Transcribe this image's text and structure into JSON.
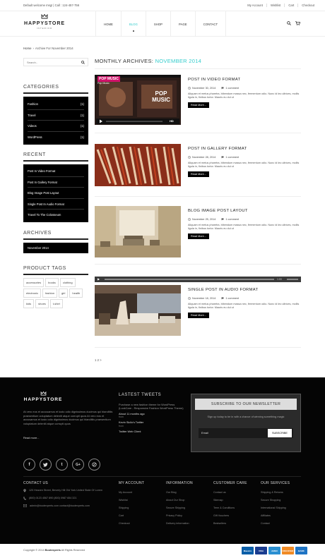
{
  "topbar": {
    "welcome": "Default welcome msg! | Call : 124-457-756",
    "links": [
      "My Account",
      "Wishlist",
      "Cart",
      "Checkout"
    ]
  },
  "header": {
    "logo_name": "HAPPYSTORE",
    "logo_sub": "INTERIOR",
    "nav": [
      "HOME",
      "BLOG",
      "SHOP",
      "PAGE",
      "CONTACT"
    ],
    "active_nav": "BLOG",
    "icons": [
      "search-icon",
      "cart-icon"
    ]
  },
  "breadcrumb": {
    "home": "Home",
    "current": "Archive For November 2014"
  },
  "sidebar": {
    "search_placeholder": "Search..",
    "categories_title": "CATEGORIES",
    "categories": [
      {
        "name": "Fashion",
        "count": "(1)"
      },
      {
        "name": "Travel",
        "count": "(1)"
      },
      {
        "name": "Videos",
        "count": "(1)"
      },
      {
        "name": "WordPress",
        "count": "(1)"
      }
    ],
    "recent_title": "RECENT",
    "recent": [
      "Post In Video Format",
      "Post In Gallery Format",
      "Blog Image Post Layout",
      "Single Post In Audio Format",
      "Travel To The Colosseum"
    ],
    "archives_title": "ARCHIVES",
    "archives": [
      "November 2014"
    ],
    "tags_title": "PRODUCT TAGS",
    "tags": [
      "accessories",
      "books",
      "clothing",
      "electronic",
      "fashion",
      "girl",
      "health",
      "kids",
      "shoes",
      "t-shirt"
    ]
  },
  "main": {
    "archive_label": "MONTHLY ARCHIVES: ",
    "archive_month": "NOVEMBER 2014",
    "posts": [
      {
        "title": "POST IN VIDEO FORMAT",
        "date": "November 30, 2014",
        "comments": "1 comment",
        "excerpt": "Aliquam et metus pharetra, bibendum massa nec, fermentum odio. Nunc id leo ultrices, mollis ligula in, finibus tortor. Mauris eu dui ut",
        "more": "Read More..."
      },
      {
        "title": "POST IN GALLERY FORMAT",
        "date": "November 28, 2014",
        "comments": "1 comment",
        "excerpt": "Aliquam et metus pharetra, bibendum massa nec, fermentum odio. Nunc id leo ultrices, mollis ligula in, finibus tortor. Mauris eu dui ut",
        "more": "Read More..."
      },
      {
        "title": "BLOG IMAGE POST LAYOUT",
        "date": "November 25, 2014",
        "comments": "1 comment",
        "excerpt": "Aliquam et metus pharetra, bibendum massa nec, fermentum odio. Nunc id leo ultrices, mollis ligula in, finibus tortor. Mauris eu dui ut",
        "more": "Read More..."
      },
      {
        "title": "SINGLE POST IN AUDIO FORMAT",
        "date": "November 18, 2014",
        "comments": "1 comment",
        "excerpt": "Aliquam et metus pharetra, bibendum massa nec, fermentum odio. Nunc id leo ultrices, mollis ligula in, finibus tortor. Mauris eu dui ut",
        "more": "Read More..."
      }
    ],
    "video_thumb": {
      "badge": "POP MUSIC",
      "caption": "Pop Music",
      "hd": "HD"
    },
    "audio_time": "1:00",
    "pagination": "1  2  >"
  },
  "footer": {
    "logo_name": "HAPPYSTORE",
    "about": "At vero eos et accusamus et iusto odio dignissimos ducimus qui blanditiis praesentium voluptatum deleniti atque corrupti quos At vero eos et accusamus et iusto odio dignissimos ducimus qui blanditiis praesentium voluptatum deleniti atque corrupti quos",
    "read_more": "Read more...",
    "tweets_title": "LASTEST TWEETS",
    "tweet_text": "Purchase a new fashion theme for WordPress (LookCare - Responsive Fashion WordPress Theme)",
    "tweet_time": "About 11 months ago",
    "tweet_from": "from",
    "tweet_author": "Kevin Sicilo's Twitter",
    "tweet_via": "from",
    "tweet_client": "Twitter Web Client",
    "newsletter_title": "SUBSCRIBE TO OUR NEWSLETTER",
    "newsletter_text": "Sign up today to be in with a chance of winning something magic",
    "newsletter_placeholder": "Email",
    "newsletter_button": "SUBSCRIBE",
    "socials": [
      "f",
      "t-bird",
      "t",
      "G+",
      "rss"
    ],
    "contact_title": "CONTACT US",
    "contact": [
      "120 Heaven Street, Beverly Hill Old York United State Of Lorem",
      "(800) 0123 4567 890 (800) 0987 654 321",
      "admin@bootexperts.com contact@bootexperts.com"
    ],
    "columns": [
      {
        "title": "MY ACCOUNT",
        "items": [
          "My Account",
          "Wishlist",
          "Shipping",
          "Cart",
          "Checkout"
        ]
      },
      {
        "title": "INFORMATION",
        "items": [
          "Our Blog",
          "About Our Shop",
          "Secure Shipping",
          "Privacy Policy",
          "Delivery information"
        ]
      },
      {
        "title": "CUSTOMER CARE",
        "items": [
          "Contact us",
          "Sitemap",
          "Term & Conditions",
          "Gift Vouchers",
          "Bestsellers"
        ]
      },
      {
        "title": "OUR SERVICES",
        "items": [
          "Shipping & Returns",
          "Secure Shopping",
          "International Shipping",
          "Affiliates",
          "Contact"
        ]
      }
    ]
  },
  "bottom": {
    "copyright_pre": "Copyright © 2014 ",
    "brand": "Bootexperts",
    "copyright_post": " All Rights Reserved",
    "payments": [
      "Maestro",
      "VISA",
      "AMEX",
      "DISCOVER",
      "BANK"
    ]
  }
}
